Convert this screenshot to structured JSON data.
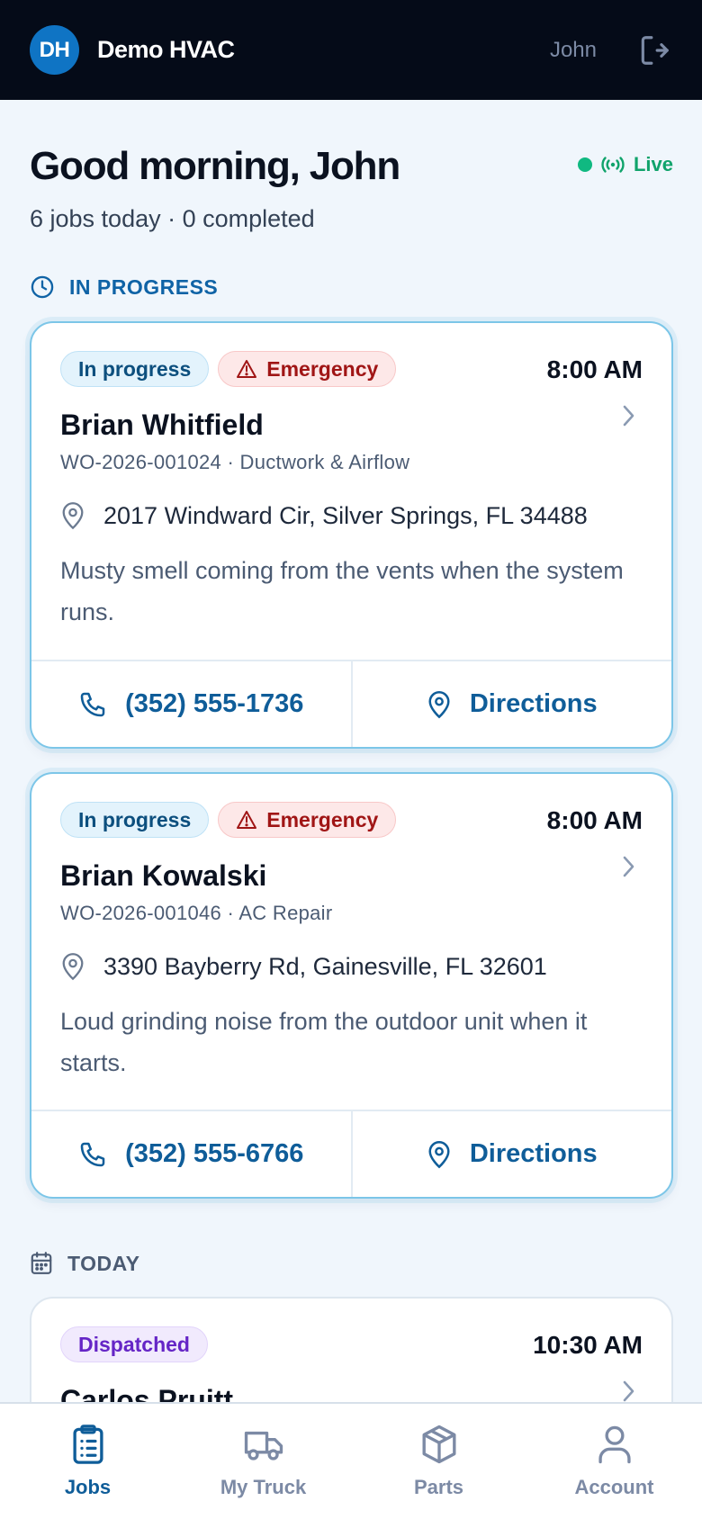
{
  "header": {
    "logo_initials": "DH",
    "brand": "Demo HVAC",
    "user": "John"
  },
  "greeting": {
    "title": "Good morning, John",
    "subtitle": "6 jobs today · 0 completed",
    "live_label": "Live"
  },
  "sections": {
    "in_progress": "IN PROGRESS",
    "today": "TODAY"
  },
  "jobs": [
    {
      "status": "In progress",
      "priority": "Emergency",
      "time": "8:00 AM",
      "customer": "Brian Whitfield",
      "wo_line": "WO-2026-001024 · Ductwork & Airflow",
      "address": "2017 Windward Cir, Silver Springs, FL 34488",
      "description": "Musty smell coming from the vents when the system runs.",
      "phone": "(352) 555-1736",
      "directions_label": "Directions"
    },
    {
      "status": "In progress",
      "priority": "Emergency",
      "time": "8:00 AM",
      "customer": "Brian Kowalski",
      "wo_line": "WO-2026-001046 · AC Repair",
      "address": "3390 Bayberry Rd, Gainesville, FL 32601",
      "description": "Loud grinding noise from the outdoor unit when it starts.",
      "phone": "(352) 555-6766",
      "directions_label": "Directions"
    },
    {
      "status": "Dispatched",
      "time": "10:30 AM",
      "customer": "Carlos Pruitt"
    }
  ],
  "nav": [
    {
      "label": "Jobs",
      "icon": "clipboard-list-icon",
      "active": true
    },
    {
      "label": "My Truck",
      "icon": "truck-icon",
      "active": false
    },
    {
      "label": "Parts",
      "icon": "package-box-icon",
      "active": false
    },
    {
      "label": "Account",
      "icon": "user-icon",
      "active": false
    }
  ],
  "colors": {
    "header_bg": "#050b18",
    "accent": "#0f5d99",
    "live": "#10b981",
    "emergency": "#a01515",
    "dispatched": "#6525c6"
  }
}
